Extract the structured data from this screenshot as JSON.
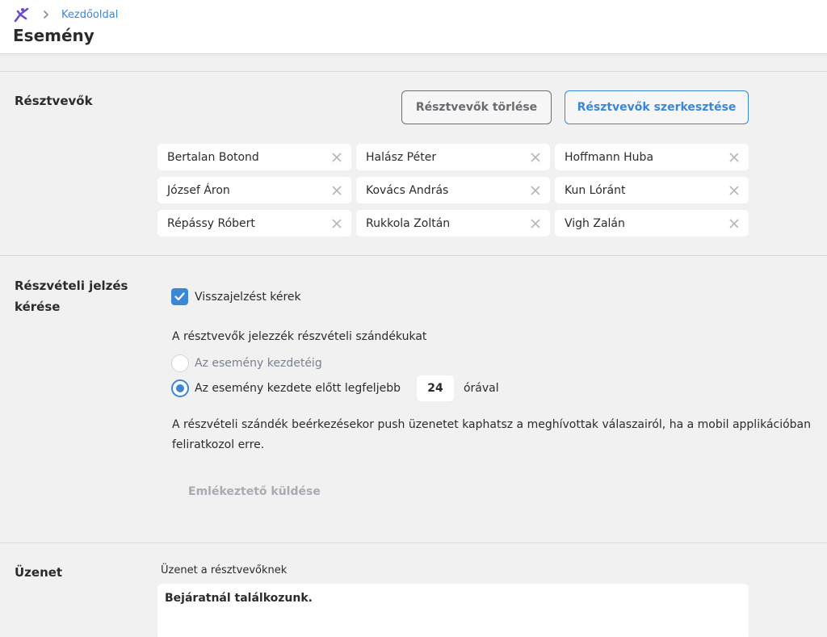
{
  "header": {
    "logo_icon": "person-star-icon",
    "breadcrumb_link": "Kezdőoldal",
    "title": "Esemény",
    "accent": "#3c86d6",
    "logo_color": "#6b4bc8"
  },
  "participants": {
    "section_title": "Résztvevők",
    "delete_button": "Résztvevők törlése",
    "edit_button": "Résztvevők szerkesztése",
    "chips": [
      "Bertalan Botond",
      "Halász Péter",
      "Hoffmann Huba",
      "József Áron",
      "Kovács András",
      "Kun Lóránt",
      "Répássy Róbert",
      "Rukkola Zoltán",
      "Vigh Zalán"
    ]
  },
  "rsvp": {
    "section_title_line1": "Részvételi jelzés",
    "section_title_line2": "kérése",
    "checkbox_label": "Visszajelzést kérek",
    "checkbox_checked": true,
    "description": "A résztvevők jelezzék részvételi szándékukat",
    "option_until_start": "Az esemény kezdetéig",
    "option_before_start": "Az esemény kezdete előtt legfeljebb",
    "selected_option": "option_before_start",
    "hours_value": "24",
    "hours_unit": "órával",
    "push_note": "A részvételi szándék beérkezésekor push üzenetet kaphatsz a meghívottak válaszairól, ha a mobil applikációban feliratkozol erre.",
    "reminder_button": "Emlékeztető küldése"
  },
  "message": {
    "section_title": "Üzenet",
    "field_label": "Üzenet a résztvevőknek",
    "field_value": "Bejáratnál találkozunk."
  }
}
